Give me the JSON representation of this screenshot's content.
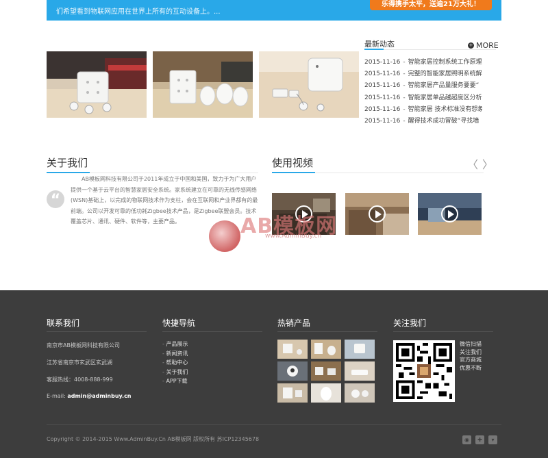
{
  "banner": {
    "text": "们希望看到物联网应用在世界上所有的互动设备上。...",
    "button": "乐得携手太平，送逾21万大礼！"
  },
  "news": {
    "title": "最新动态",
    "more": "MORE",
    "items": [
      {
        "date": "2015-11-16",
        "title": "智能家居控制系统工作原理"
      },
      {
        "date": "2015-11-16",
        "title": "完整的智能家居照明系统解"
      },
      {
        "date": "2015-11-16",
        "title": "智能家居产品量服务要要“"
      },
      {
        "date": "2015-11-16",
        "title": "智能家居单品越超度区分析"
      },
      {
        "date": "2015-11-16",
        "title": "智能家居 技术标准没有想象"
      },
      {
        "date": "2015-11-16",
        "title": "醒得技术成功冒破“寻找墙"
      }
    ]
  },
  "about": {
    "title": "关于我们",
    "text": "AB模板网科技有限公司于2011年成立于中国和美国，致力于为广大用户提供一个基于云平台的智慧家居安全系统。家系统建立在可靠的无线传感网络(WSN)基础上，以完成的物联网技术作为支柱，会在互联网和产业界都有的最前端。公司以开发可靠的低功耗Zigbee技术产品，是Zigbee联盟会员。技术覆盖芯片、通讯、硬件、软件等，主要产品。"
  },
  "video": {
    "title": "使用视频",
    "prev": "〈",
    "next": "〉"
  },
  "watermark": {
    "text": "AB模板网",
    "sub": "www.AdminBuy.cn"
  },
  "footer": {
    "contact_title": "联系我们",
    "company": "南京市AB模板网科技有限公司",
    "address": "江苏省南京市玄武区玄武湖",
    "phone": "客服热线：4008-888-999",
    "email_label": "E-mail: ",
    "email": "admin@adminbuy.cn",
    "nav_title": "快捷导航",
    "nav_items": [
      "产品展示",
      "新闻资讯",
      "帮助中心",
      "关于我们",
      "APP下载"
    ],
    "hot_title": "热销产品",
    "follow_title": "关注我们",
    "follow_items": [
      "微信扫描",
      "关注我们",
      "官方商城",
      "优惠不断"
    ],
    "copyright": "Copyright © 2014-2015 Www.AdminBuy.Cn AB模板网 版权所有 苏ICP12345678"
  },
  "colors": {
    "accent": "#29a8e8",
    "banner_button": "#f07a1c",
    "footer_bg": "#3d3d3d"
  },
  "icons": {
    "quote": "quote-icon",
    "play": "play-icon",
    "social": [
      "weibo-icon",
      "qq-icon",
      "cart-icon"
    ]
  }
}
